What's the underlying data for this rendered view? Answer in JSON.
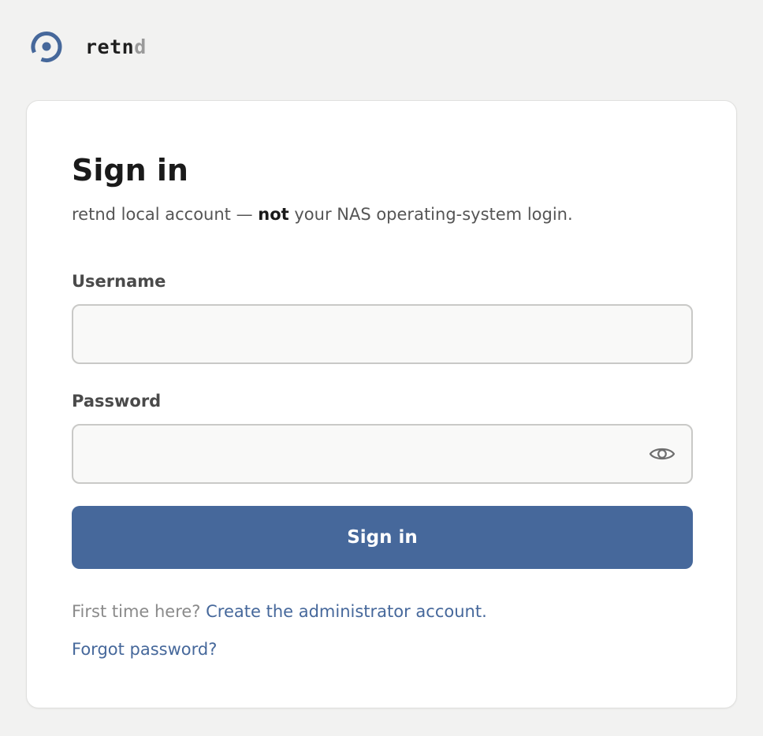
{
  "brand": {
    "name_main": "retn",
    "name_dim": "d",
    "logo_icon": "retnd-ring-logo",
    "accent_color": "#46689b"
  },
  "login": {
    "title": "Sign in",
    "subtitle_before": "retnd local account — ",
    "subtitle_emphasis": "not",
    "subtitle_after": " your NAS operating-system login.",
    "username_label": "Username",
    "username_value": "",
    "password_label": "Password",
    "password_value": "",
    "password_toggle_icon": "eye-icon",
    "submit_label": "Sign in",
    "first_time_text": "First time here? ",
    "create_admin_link": "Create the administrator account.",
    "forgot_password_link": "Forgot password?"
  }
}
